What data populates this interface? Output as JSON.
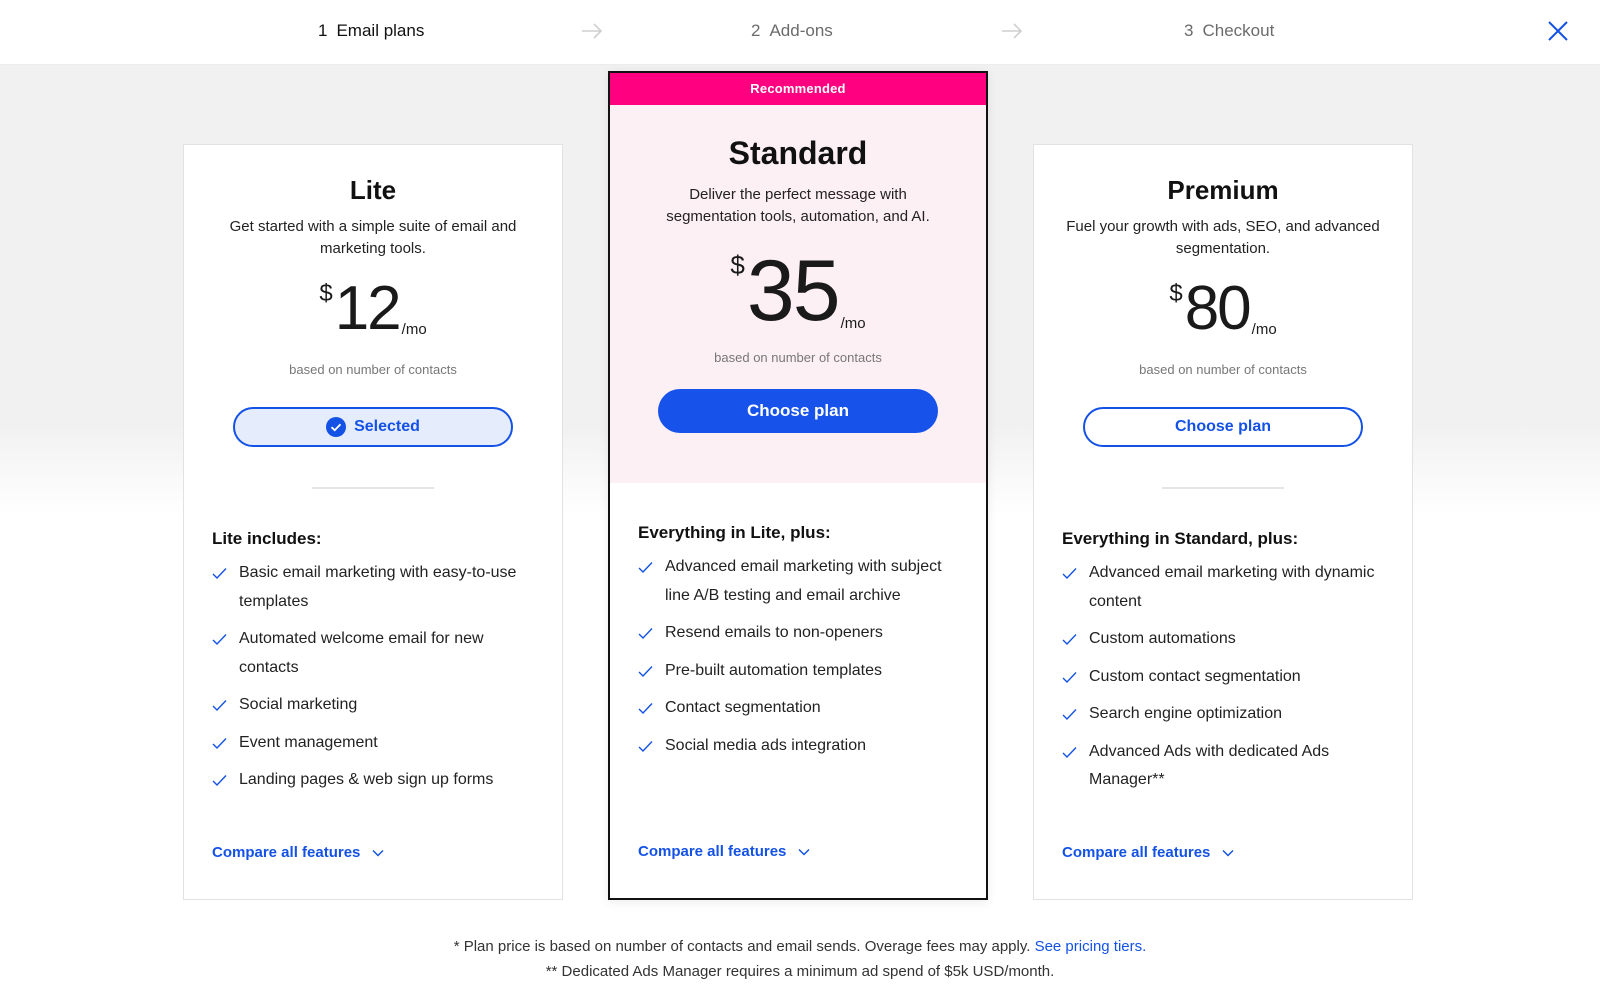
{
  "stepper": {
    "steps": [
      {
        "num": "1",
        "label": "Email plans",
        "active": true
      },
      {
        "num": "2",
        "label": "Add-ons",
        "active": false
      },
      {
        "num": "3",
        "label": "Checkout",
        "active": false
      }
    ],
    "close_icon": "close-icon",
    "arrow_icon": "arrow-right-icon"
  },
  "colors": {
    "accent_blue": "#1452e6",
    "recommended_pink": "#ff0080",
    "standard_bg": "#fdf0f4",
    "page_bg": "#f1f1f1"
  },
  "plans": [
    {
      "name": "Lite",
      "description": "Get started with a simple suite of email and marketing tools.",
      "currency": "$",
      "price": "12",
      "period": "/mo",
      "price_note": "based on number of contacts",
      "button_label": "Selected",
      "button_state": "selected",
      "features_title": "Lite includes:",
      "features": [
        "Basic email marketing with easy-to-use templates",
        "Automated welcome email for new contacts",
        "Social marketing",
        "Event management",
        "Landing pages & web sign up forms"
      ],
      "compare_label": "Compare all features"
    },
    {
      "name": "Standard",
      "badge": "Recommended",
      "description": "Deliver the perfect message with segmentation tools, automation, and AI.",
      "currency": "$",
      "price": "35",
      "period": "/mo",
      "price_note": "based on number of contacts",
      "button_label": "Choose plan",
      "button_state": "primary",
      "features_title": "Everything in Lite, plus:",
      "features": [
        "Advanced email marketing with subject line A/B testing and email archive",
        "Resend emails to non-openers",
        "Pre-built automation templates",
        "Contact segmentation",
        "Social media ads integration"
      ],
      "compare_label": "Compare all features"
    },
    {
      "name": "Premium",
      "description": "Fuel your growth with ads, SEO, and advanced segmentation.",
      "currency": "$",
      "price": "80",
      "period": "/mo",
      "price_note": "based on number of contacts",
      "button_label": "Choose plan",
      "button_state": "outline",
      "features_title": "Everything in Standard, plus:",
      "features": [
        "Advanced email marketing with dynamic content",
        "Custom automations",
        "Custom contact segmentation",
        "Search engine optimization",
        "Advanced Ads with dedicated Ads Manager**"
      ],
      "compare_label": "Compare all features"
    }
  ],
  "footnotes": {
    "line1": "* Plan price is based on number of contacts and email sends. Overage fees may apply.",
    "line1_link": "See pricing tiers.",
    "line2": "** Dedicated Ads Manager requires a minimum ad spend of $5k USD/month."
  }
}
